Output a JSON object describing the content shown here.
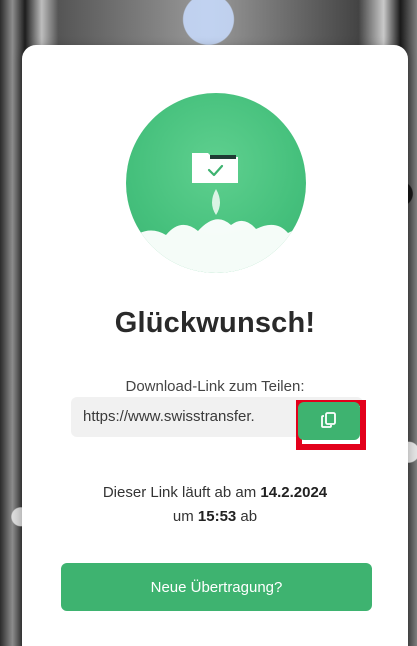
{
  "dialog": {
    "title": "Glückwunsch!",
    "share_label": "Download-Link zum Teilen:",
    "link_value": "https://www.swisstransfer.",
    "expiry": {
      "prefix": "Dieser Link läuft ab am ",
      "date": "14.2.2024",
      "time_prefix": "um ",
      "time": "15:53",
      "suffix": " ab"
    },
    "new_transfer_label": "Neue Übertragung?"
  },
  "icons": {
    "copy": "copy-icon",
    "hero": "folder-rocket-illustration"
  },
  "colors": {
    "primary_green": "#3eb370",
    "hero_green": "#45c07c",
    "highlight_red": "#e3001b"
  }
}
